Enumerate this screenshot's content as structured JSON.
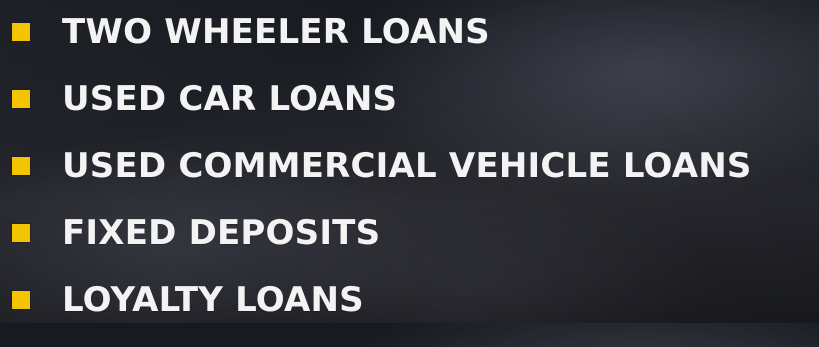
{
  "theme": {
    "bullet_color": "#f4c400",
    "text_color": "#f3f3f3"
  },
  "items": [
    {
      "label": "TWO WHEELER LOANS"
    },
    {
      "label": "USED CAR LOANS"
    },
    {
      "label": "USED COMMERCIAL VEHICLE LOANS"
    },
    {
      "label": "FIXED DEPOSITS"
    },
    {
      "label": "LOYALTY LOANS"
    }
  ]
}
